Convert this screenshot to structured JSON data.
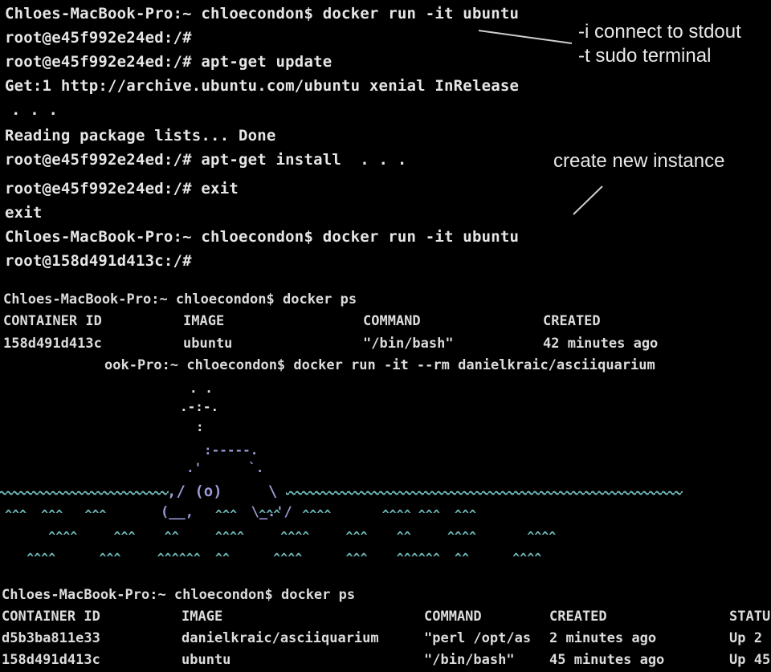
{
  "terminal1": {
    "lines": [
      "Chloes-MacBook-Pro:~ chloecondon$ docker run -it ubuntu",
      "root@e45f992e24ed:/#",
      "root@e45f992e24ed:/# apt-get update",
      "Get:1 http://archive.ubuntu.com/ubuntu xenial InRelease",
      ". . .",
      "Reading package lists... Done",
      "root@e45f992e24ed:/# apt-get install  . . .",
      "root@e45f992e24ed:/# exit",
      "exit",
      "Chloes-MacBook-Pro:~ chloecondon$ docker run -it ubuntu",
      "root@158d491d413c:/#"
    ]
  },
  "annotations": {
    "flag_i": "-i connect to stdout",
    "flag_t": "-t sudo terminal",
    "new_instance": "create new instance"
  },
  "terminal2": {
    "prompt": "Chloes-MacBook-Pro:~ chloecondon$ docker ps",
    "headers": [
      "CONTAINER ID",
      "IMAGE",
      "COMMAND",
      "CREATED"
    ],
    "row": [
      "158d491d413c",
      "ubuntu",
      "\"/bin/bash\"",
      "42 minutes ago"
    ],
    "run_line": "ook-Pro:~ chloecondon$ docker run -it --rm danielkraic/asciiquarium"
  },
  "aquarium": {
    "spout": [
      ". .",
      ".-:-.",
      ":"
    ],
    "whale": [
      ":-----.",
      ".'      `.",
      ",/ (o)     \\",
      "(__,       \\_.'/"
    ],
    "caret_rows": [
      "^^^  ^^^   ^^^               ^^^   ^^^   ^^^^       ^^^^ ^^^  ^^^",
      "      ^^^^     ^^^    ^^     ^^^^     ^^^^     ^^^    ^^     ^^^^       ^^^^",
      "   ^^^^      ^^^     ^^^^^^  ^^      ^^^^      ^^^    ^^^^^^  ^^      ^^^^"
    ],
    "water_color": "#6fb9b9",
    "whale_color": "#9a9ad8"
  },
  "terminal3": {
    "prompt": "Chloes-MacBook-Pro:~ chloecondon$ docker ps",
    "headers": [
      "CONTAINER ID",
      "IMAGE",
      "COMMAND",
      "CREATED",
      "STATU"
    ],
    "rows": [
      [
        "d5b3ba811e33",
        "danielkraic/asciiquarium",
        "\"perl /opt/as",
        "2 minutes ago",
        "Up 2"
      ],
      [
        "158d491d413c",
        "ubuntu",
        "\"/bin/bash\"",
        "45 minutes ago",
        "Up 45"
      ]
    ]
  }
}
